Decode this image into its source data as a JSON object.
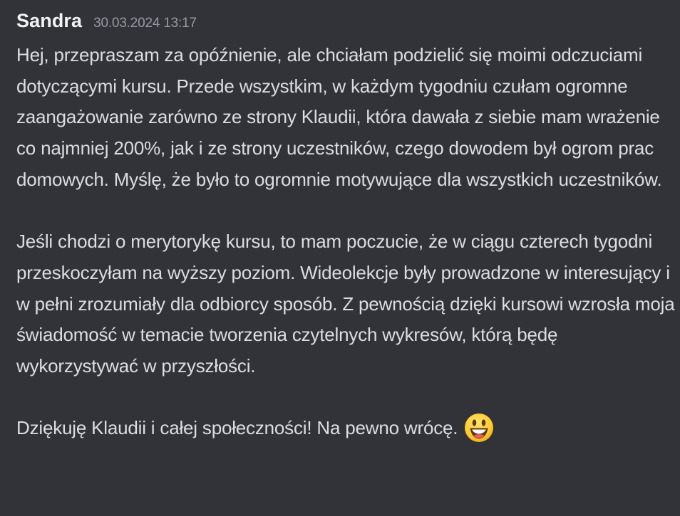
{
  "message": {
    "author": "Sandra",
    "timestamp": "30.03.2024 13:17",
    "paragraphs": [
      "Hej, przepraszam za opóźnienie, ale chciałam podzielić się moimi odczuciami dotyczącymi kursu. Przede wszystkim, w każdym tygodniu czułam ogromne zaangażowanie zarówno ze strony Klaudii, która dawała z siebie mam wrażenie co najmniej 200%, jak i ze strony uczestników, czego dowodem był ogrom prac domowych. Myślę, że było to ogromnie motywujące dla wszystkich uczestników.",
      "Jeśli chodzi o merytorykę kursu, to mam poczucie, że w ciągu czterech tygodni przeskoczyłam na wyższy poziom. Wideolekcje były prowadzone w interesujący i w pełni zrozumiały dla odbiorcy sposób. Z pewnością dzięki kursowi wzrosła moja świadomość w temacie tworzenia czytelnych wykresów, którą będę wykorzystywać w przyszłości.",
      "Dziękuję Klaudii i całej społeczności! Na pewno wrócę."
    ],
    "emoji": "smiley-emoji"
  }
}
